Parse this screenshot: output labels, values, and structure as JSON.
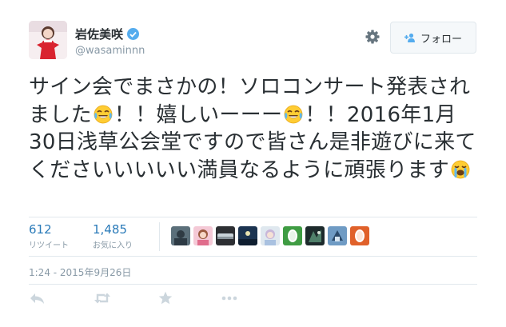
{
  "user": {
    "display_name": "岩佐美咲",
    "handle": "@wasaminnn"
  },
  "follow_button": {
    "label": "フォロー"
  },
  "tweet": {
    "segments": [
      "サイン会でまさかの！ソロコンサート発表されました",
      "！！嬉しいーーー",
      "！！2016年1月30日浅草公会堂ですので皆さん是非遊びに来てくださいいいいい満員なるように頑張ります"
    ]
  },
  "stats": {
    "retweets": {
      "count": "612",
      "label": "リツイート"
    },
    "favorites": {
      "count": "1,485",
      "label": "お気に入り"
    }
  },
  "favoriter_avatars": [
    "avatar-1",
    "avatar-2",
    "avatar-3",
    "avatar-4",
    "avatar-5",
    "avatar-6",
    "avatar-7",
    "avatar-8",
    "avatar-9"
  ],
  "timestamp": "1:24 - 2015年9月26日",
  "icons": {
    "verified": "verified-badge-icon",
    "settings": "gear-icon",
    "follow": "add-user-icon",
    "emoji": "face-with-tears-of-joy-icon",
    "reply": "reply-icon",
    "retweet": "retweet-icon",
    "favorite": "star-icon",
    "more": "more-icon"
  },
  "colors": {
    "link": "#2b7bb9",
    "verified": "#55acee",
    "muted": "#8899a6"
  }
}
